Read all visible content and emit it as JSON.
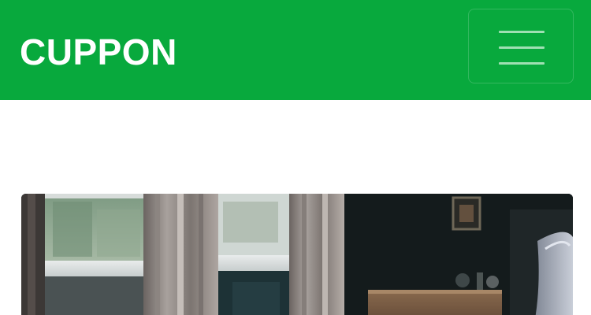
{
  "navbar": {
    "brand": "CUPPON",
    "menu_icon": "hamburger-menu-icon",
    "background_color": "#08a93d"
  },
  "hero": {
    "image_subject": "bedroom-with-curtained-windows"
  }
}
